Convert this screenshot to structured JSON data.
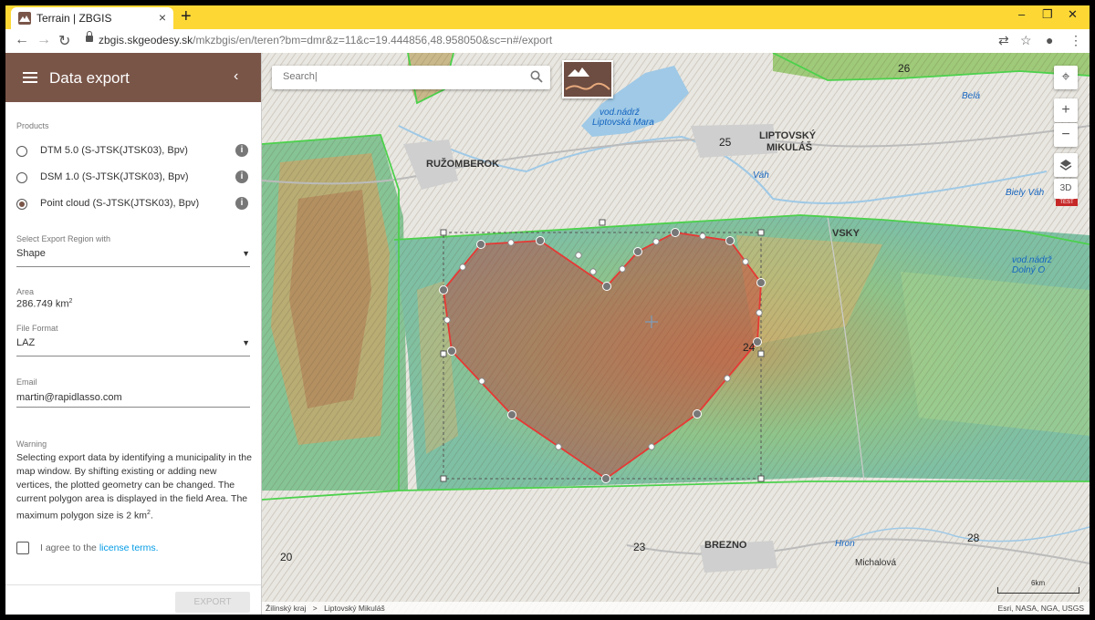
{
  "browser": {
    "tab_title": "Terrain | ZBGIS",
    "new_tab": "+",
    "url_host": "zbgis.skgeodesy.sk",
    "url_path": "/mkzbgis/en/teren?bm=dmr&z=11&c=19.444856,48.958050&sc=n#/export"
  },
  "sidebar": {
    "title": "Data export",
    "products_label": "Products",
    "products": [
      {
        "label": "DTM 5.0 (S-JTSK(JTSK03), Bpv)",
        "checked": false
      },
      {
        "label": "DSM 1.0 (S-JTSK(JTSK03), Bpv)",
        "checked": false
      },
      {
        "label": "Point cloud (S-JTSK(JTSK03), Bpv)",
        "checked": true
      }
    ],
    "region_label": "Select Export Region with",
    "region_value": "Shape",
    "area_label": "Area",
    "area_value": "286.749 km",
    "area_unit_sup": "2",
    "format_label": "File Format",
    "format_value": "LAZ",
    "email_label": "Email",
    "email_value": "martin@rapidlasso.com",
    "warning_label": "Warning",
    "warning_text": "Selecting export data by identifying a municipality in the map window. By shifting existing or adding new vertices, the plotted geometry can be changed. The current polygon area is displayed in the field Area. The maximum polygon size is 2 km",
    "warning_sup": "2",
    "warning_end": ".",
    "agree_text": "I agree to the",
    "license_link": "license terms.",
    "export_button": "EXPORT"
  },
  "map": {
    "search_placeholder": "Search|",
    "btn_3d": "3D",
    "test_badge": "TEST",
    "places": {
      "ruzomberok": "RUŽOMBEROK",
      "liptovsky1": "LIPTOVSKÝ",
      "liptovsky2": "MIKULÁŠ",
      "brezno": "BREZNO",
      "vodnadrz1": "vod.nádrž",
      "vodnadrz2": "Liptovská Mara",
      "vah": "Váh",
      "biely_vah": "Biely Váh",
      "bela": "Belá",
      "vod2": "vod.nádrž",
      "dolny": "Dolný O",
      "hron": "Hron",
      "chocholna": "Michalová",
      "vysky": "VSKY"
    },
    "road_numbers": [
      "26",
      "25",
      "24",
      "23",
      "20",
      "28"
    ],
    "breadcrumb": [
      "Žilinský kraj",
      "Liptovský Mikuláš"
    ],
    "breadcrumb_sep": ">",
    "attribution": "Esri, NASA, NGA, USGS",
    "scale_label": "6km"
  },
  "colors": {
    "tab_strip": "#fdd835",
    "sidebar_header": "#795548",
    "polygon_stroke": "#e53935",
    "polygon_fill": "#c62828",
    "boundary": "#4cd14c",
    "link": "#039be5"
  }
}
